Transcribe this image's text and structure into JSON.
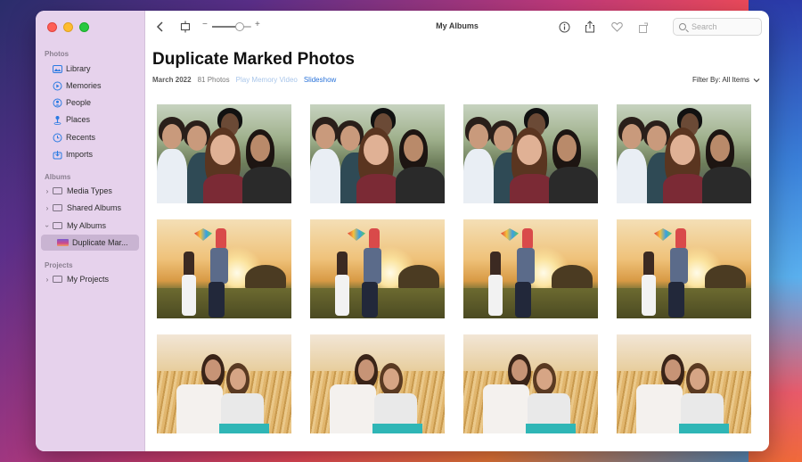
{
  "window": {
    "title": "My Albums"
  },
  "sidebar": {
    "sections": [
      {
        "title": "Photos",
        "items": [
          {
            "label": "Library",
            "icon": "library-icon"
          },
          {
            "label": "Memories",
            "icon": "memories-icon"
          },
          {
            "label": "People",
            "icon": "people-icon"
          },
          {
            "label": "Places",
            "icon": "places-icon"
          },
          {
            "label": "Recents",
            "icon": "recents-icon"
          },
          {
            "label": "Imports",
            "icon": "imports-icon"
          }
        ]
      },
      {
        "title": "Albums",
        "items": [
          {
            "label": "Media Types"
          },
          {
            "label": "Shared Albums"
          },
          {
            "label": "My Albums"
          },
          {
            "label": "Duplicate Mar..."
          }
        ]
      },
      {
        "title": "Projects",
        "items": [
          {
            "label": "My Projects"
          }
        ]
      }
    ]
  },
  "toolbar": {
    "zoom_minus": "−",
    "zoom_plus": "+",
    "search_placeholder": "Search",
    "zoom_level": 0.7
  },
  "album": {
    "title": "Duplicate Marked Photos",
    "date": "March 2022",
    "count": "81 Photos",
    "memory_link": "Play Memory Video",
    "slideshow_link": "Slideshow",
    "filter": "Filter By: All Items"
  },
  "colors": {
    "accent": "#2a73d9",
    "sidebar_bg": "#e6d2ec",
    "selected_bg": "#c9b4d2"
  }
}
